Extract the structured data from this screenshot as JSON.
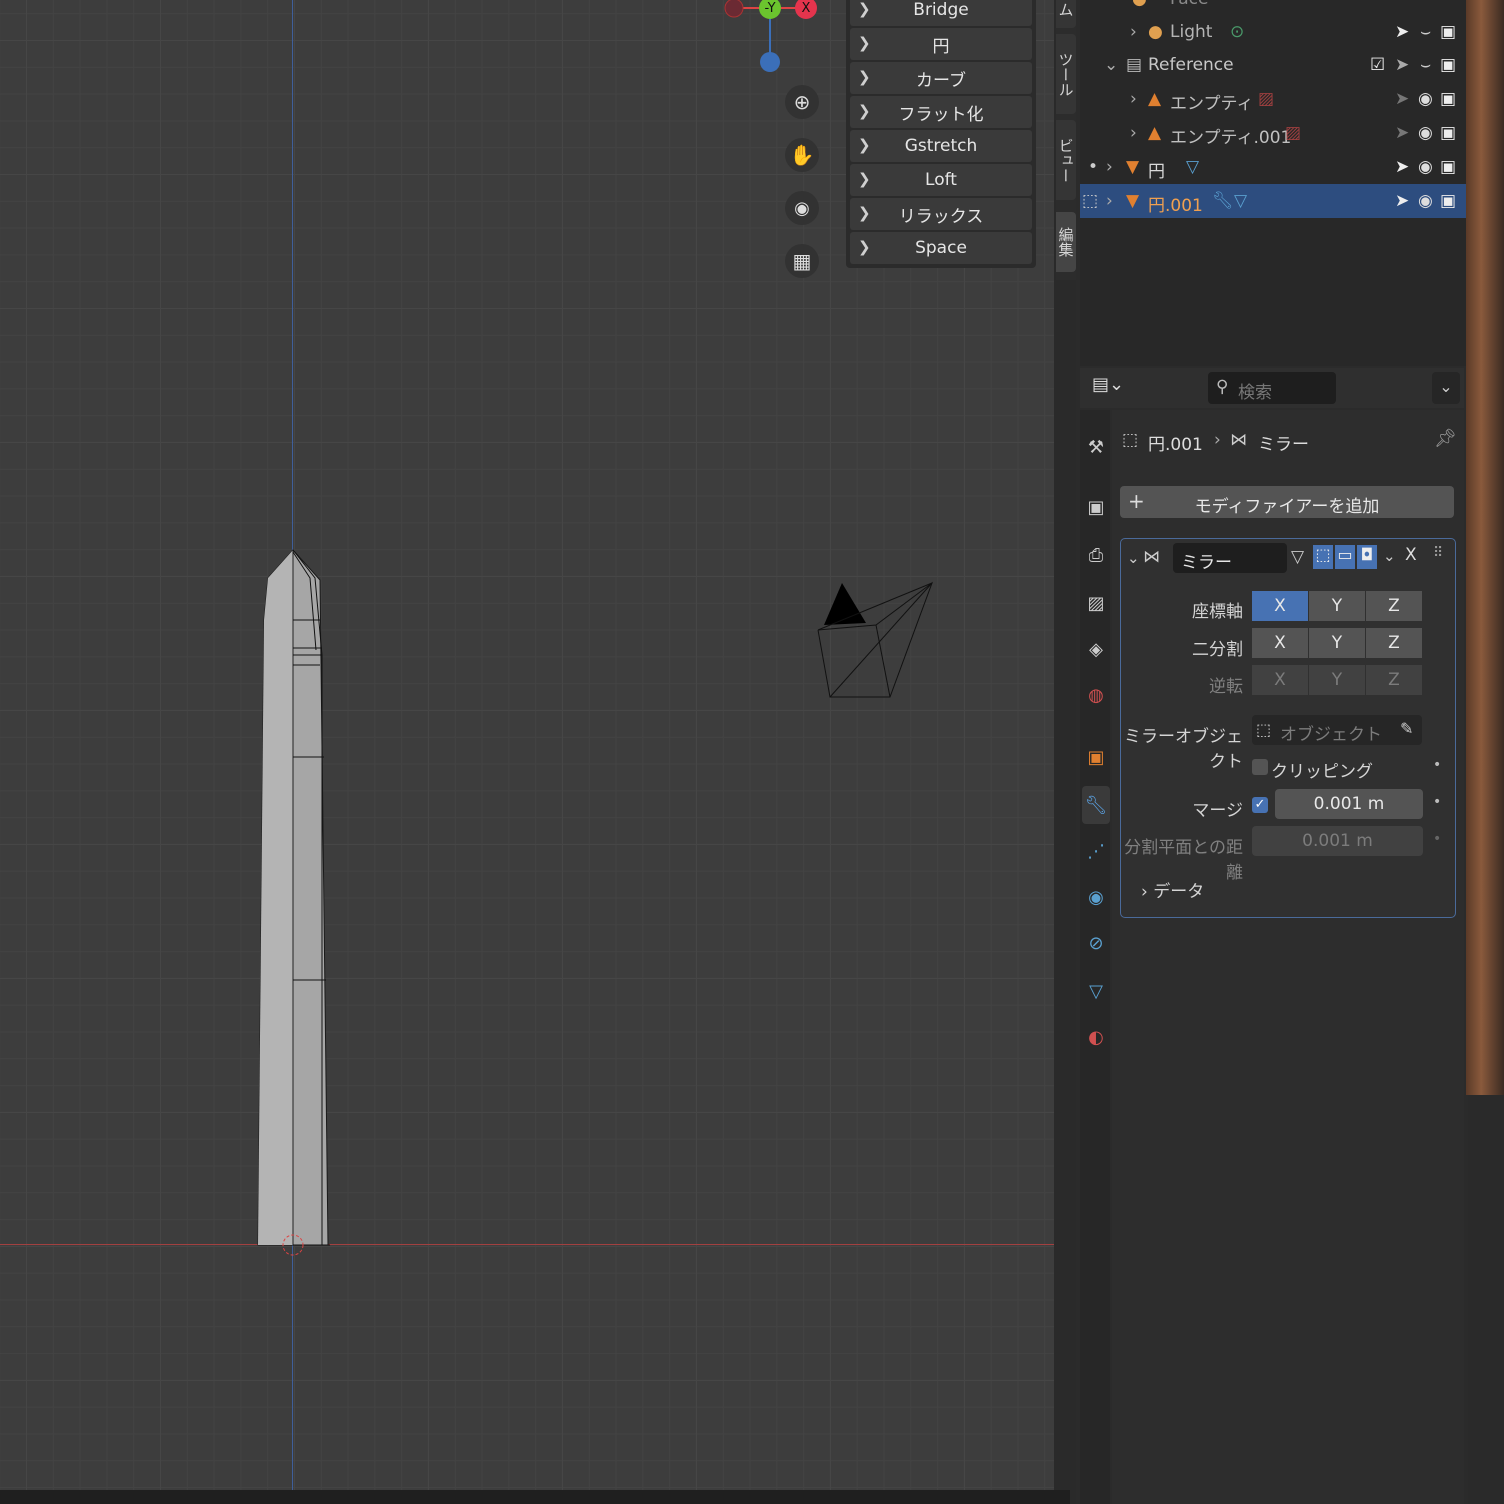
{
  "tool_menu": {
    "items": [
      "Bridge",
      "円",
      "カーブ",
      "フラット化",
      "Gstretch",
      "Loft",
      "リラックス",
      "Space"
    ]
  },
  "gizmo": {
    "y_label": "-Y",
    "x_label": "X"
  },
  "side_tabs": [
    "ム",
    "ツール",
    "ビュー",
    "編集"
  ],
  "outliner": {
    "rows": [
      {
        "name": "Face"
      },
      {
        "name": "Light"
      },
      {
        "name": "Reference"
      },
      {
        "name": "エンプティ"
      },
      {
        "name": "エンプティ.001"
      },
      {
        "name": "円"
      },
      {
        "name": "円.001",
        "selected": true
      }
    ]
  },
  "props": {
    "search_placeholder": "検索",
    "breadcrumb": {
      "object": "円.001",
      "modifier": "ミラー"
    },
    "add_modifier": "モディファイアーを追加",
    "modifier": {
      "name": "ミラー",
      "close": "X",
      "axis_label": "座標軸",
      "bisect_label": "二分割",
      "flip_label": "逆転",
      "axes": [
        "X",
        "Y",
        "Z"
      ],
      "axis_active": "X",
      "mirror_object_label": "ミラーオブジェクト",
      "mirror_object_placeholder": "オブジェクト",
      "clipping_label": "クリッピング",
      "clipping": false,
      "merge_label": "マージ",
      "merge": true,
      "merge_value": "0.001 m",
      "bisect_distance_label": "分割平面との距離",
      "bisect_distance_value": "0.001 m",
      "data_label": "データ"
    }
  },
  "colors": {
    "accent": "#4772b3",
    "selected_row": "#2d4d7f",
    "x_axis": "#e4344d",
    "y_axis": "#6bc42e",
    "z_axis": "#3b6fb9"
  }
}
